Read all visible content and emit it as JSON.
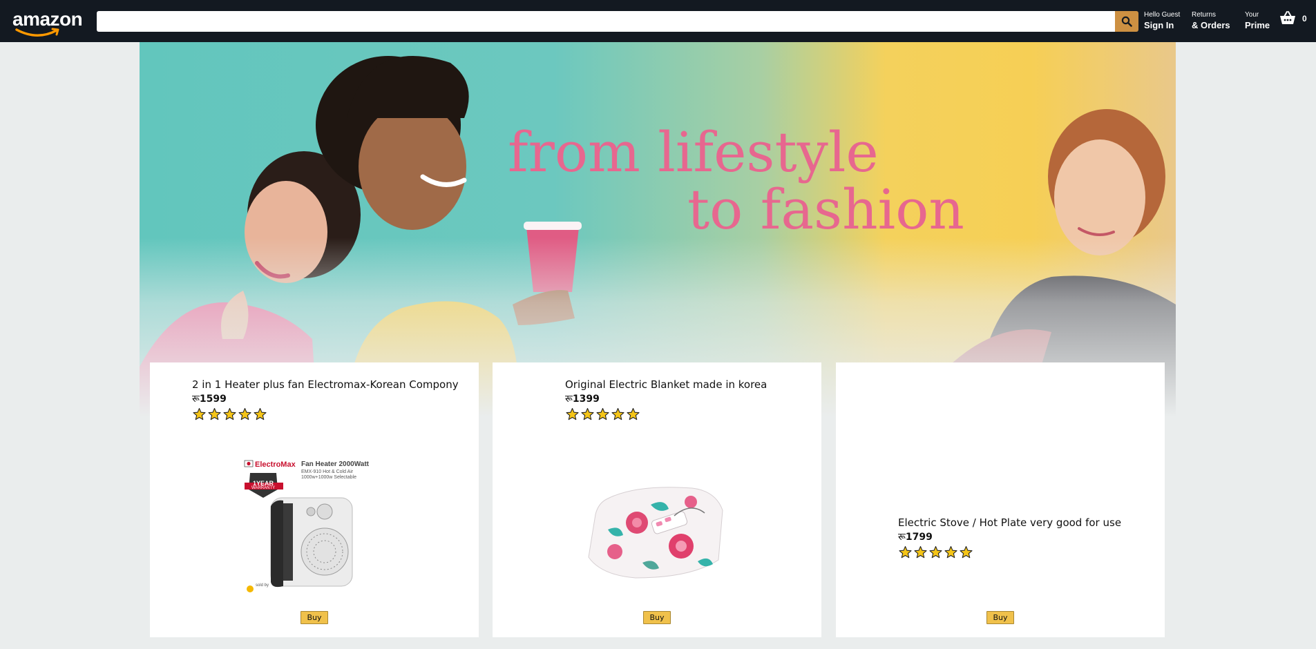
{
  "header": {
    "logo": "amazon",
    "search_placeholder": "",
    "search_icon": "magnifier-icon",
    "nav": [
      {
        "line_one": "Hello Guest",
        "line_two": "Sign In"
      },
      {
        "line_one": "Returns",
        "line_two": "& Orders"
      },
      {
        "line_one": "Your",
        "line_two": "Prime"
      }
    ],
    "basket_icon": "shopping-basket-icon",
    "basket_count": "0"
  },
  "hero": {
    "line_one": "from lifestyle",
    "line_two": "to fashion"
  },
  "products": [
    {
      "title": "2 in 1 Heater plus fan Electromax-Korean Compony",
      "currency": "रू",
      "price": "1599",
      "rating": 5,
      "buy_label": "Buy",
      "image_brand": "ElectroMax",
      "image_caption": "Fan Heater 2000Watt",
      "image_subcaption_1": "EMX-910 Hot & Cold Air",
      "image_subcaption_2": "1000w+1000w Selectable",
      "image_badge_1": "1YEAR",
      "image_badge_2": "WARRANTY",
      "image_sold_by": "sold by"
    },
    {
      "title": "Original Electric Blanket made in korea",
      "currency": "रू",
      "price": "1399",
      "rating": 5,
      "buy_label": "Buy"
    },
    {
      "title": "Electric Stove / Hot Plate very good for use",
      "currency": "रू",
      "price": "1799",
      "rating": 5,
      "buy_label": "Buy"
    }
  ],
  "colors": {
    "header_bg": "#131921",
    "search_button": "#cd9042",
    "hero_text": "#e7678f",
    "buy_button": "#f0c14b",
    "star": "#f5c518"
  }
}
